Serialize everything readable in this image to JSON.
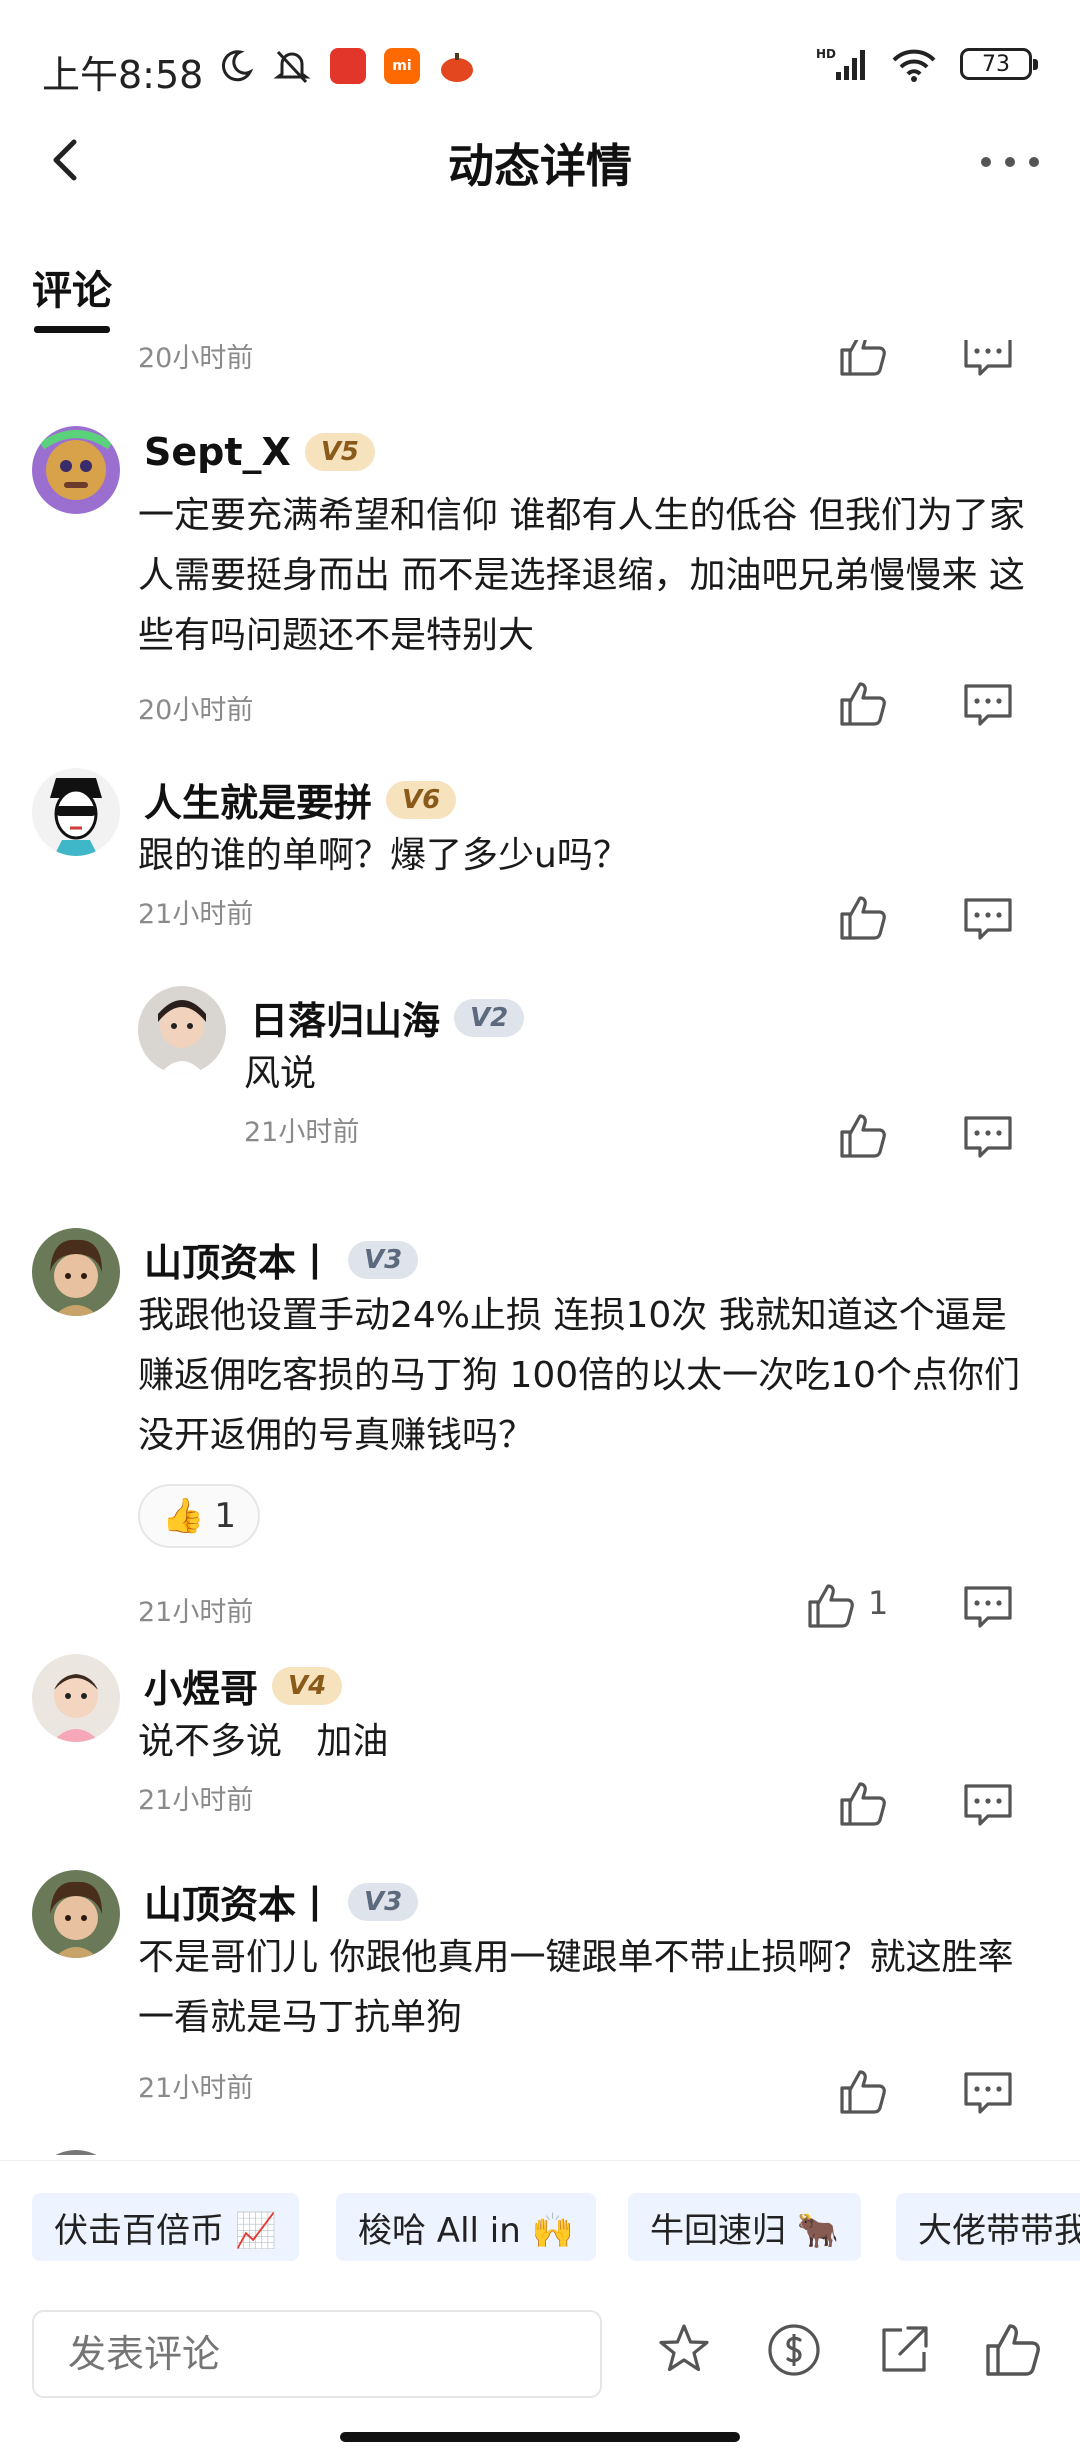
{
  "status_bar": {
    "time": "上午8:58",
    "battery": "73",
    "network": "HD"
  },
  "header": {
    "title": "动态详情"
  },
  "tabs": [
    {
      "label": "评论"
    }
  ],
  "comments": [
    {
      "timestamp": "20小时前"
    },
    {
      "username": "Sept_X",
      "level": "V5",
      "text": "一定要充满希望和信仰 谁都有人生的低谷 但我们为了家人需要挺身而出 而不是选择退缩，加油吧兄弟慢慢来 这些有吗问题还不是特别大",
      "timestamp": "20小时前"
    },
    {
      "username": "人生就是要拼",
      "level": "V6",
      "text": "跟的谁的单啊？爆了多少u吗？",
      "timestamp": "21小时前"
    },
    {
      "username": "日落归山海",
      "level": "V2",
      "text": "风说",
      "timestamp": "21小时前"
    },
    {
      "username": "山顶资本丨",
      "level": "V3",
      "text": "我跟他设置手动24%止损 连损10次 我就知道这个逼是赚返佣吃客损的马丁狗  100倍的以太一次吃10个点你们没开返佣的号真赚钱吗？",
      "reaction_emoji": "👍",
      "reaction_count": "1",
      "like_count": "1",
      "timestamp": "21小时前"
    },
    {
      "username": "小煜哥",
      "level": "V4",
      "text": "说不多说   加油",
      "timestamp": "21小时前"
    },
    {
      "username": "山顶资本丨",
      "level": "V3",
      "text": "不是哥们儿 你跟他真用一键跟单不带止损啊？就这胜率一看就是马丁抗单狗",
      "timestamp": "21小时前"
    }
  ],
  "quick_phrases": [
    {
      "label": "伏击百倍币 📈"
    },
    {
      "label": "梭哈 All in 🙌"
    },
    {
      "label": "牛回速归 🐂"
    },
    {
      "label": "大佬带带我"
    }
  ],
  "bottom_bar": {
    "input_placeholder": "发表评论"
  },
  "colors": {
    "level_gold_bg": "#f6e2bd",
    "level_silver_bg": "#dfe4ec",
    "quick_chip_bg": "#eef4ff",
    "text_muted": "#8a8a8a"
  }
}
